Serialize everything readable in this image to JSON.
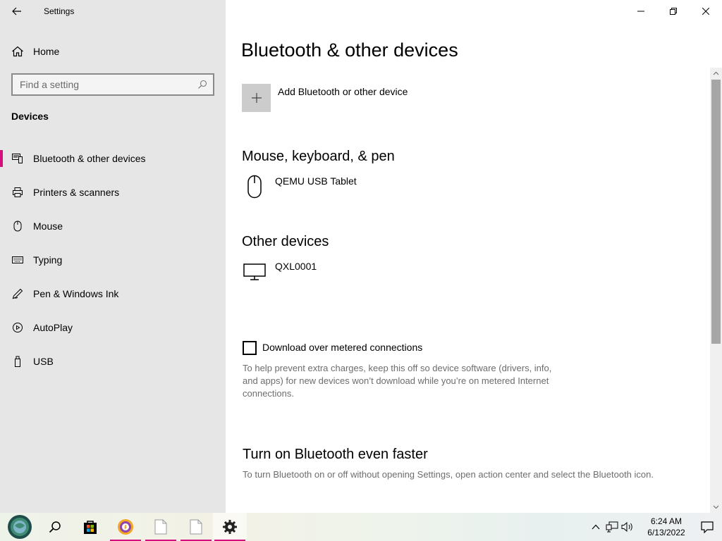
{
  "app": {
    "title": "Settings"
  },
  "window": {
    "minimize": "minimize",
    "restore": "restore",
    "close": "close"
  },
  "sidebar": {
    "home_label": "Home",
    "search_placeholder": "Find a setting",
    "section_label": "Devices",
    "items": [
      {
        "label": "Bluetooth & other devices",
        "icon": "bluetooth-devices-icon",
        "selected": true
      },
      {
        "label": "Printers & scanners",
        "icon": "printer-icon",
        "selected": false
      },
      {
        "label": "Mouse",
        "icon": "mouse-icon",
        "selected": false
      },
      {
        "label": "Typing",
        "icon": "keyboard-icon",
        "selected": false
      },
      {
        "label": "Pen & Windows Ink",
        "icon": "pen-icon",
        "selected": false
      },
      {
        "label": "AutoPlay",
        "icon": "autoplay-icon",
        "selected": false
      },
      {
        "label": "USB",
        "icon": "usb-icon",
        "selected": false
      }
    ]
  },
  "main": {
    "title": "Bluetooth & other devices",
    "add_device_label": "Add Bluetooth or other device",
    "groups": [
      {
        "heading": "Mouse, keyboard, & pen",
        "devices": [
          {
            "name": "QEMU USB Tablet",
            "icon": "mouse-icon"
          }
        ]
      },
      {
        "heading": "Other devices",
        "devices": [
          {
            "name": "QXL0001",
            "icon": "monitor-icon"
          }
        ]
      }
    ],
    "metered_checkbox_label": "Download over metered connections",
    "metered_checked": false,
    "metered_help": "To help prevent extra charges, keep this off so device software (drivers, info, and apps) for new devices won’t download while you’re on metered Internet connections.",
    "bluetooth_faster_heading": "Turn on Bluetooth even faster",
    "bluetooth_faster_help": "To turn Bluetooth on or off without opening Settings, open action center and select the Bluetooth icon."
  },
  "taskbar": {
    "pinned": [
      "start-orb-icon",
      "search-icon",
      "store-icon",
      "browser-icon",
      "document-icon",
      "document-icon",
      "settings-gear-icon"
    ],
    "clock_time": "6:24 AM",
    "clock_date": "6/13/2022"
  },
  "colors": {
    "accent": "#d40f7d",
    "sidebar_bg": "#e6e6e6",
    "help_text": "#6d6d6d"
  }
}
